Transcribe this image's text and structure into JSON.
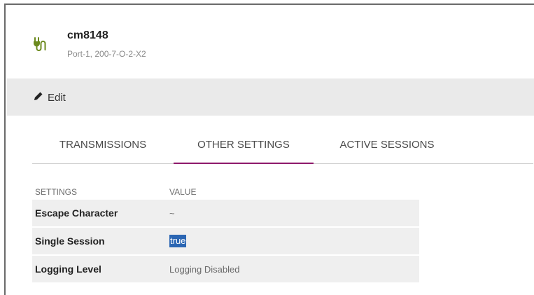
{
  "header": {
    "title": "cm8148",
    "subtitle": "Port-1, 200-7-O-2-X2",
    "icon": "plug-icon",
    "icon_color": "#6c8a1e"
  },
  "toolbar": {
    "edit_label": "Edit"
  },
  "tabs": [
    {
      "label": "TRANSMISSIONS",
      "active": false
    },
    {
      "label": "OTHER SETTINGS",
      "active": true
    },
    {
      "label": "ACTIVE SESSIONS",
      "active": false
    }
  ],
  "accent_color": "#8e1a6b",
  "table": {
    "headers": [
      "SETTINGS",
      "VALUE"
    ],
    "rows": [
      {
        "setting": "Escape Character",
        "value": "~"
      },
      {
        "setting": "Single Session",
        "value": "true",
        "selected": true
      },
      {
        "setting": "Logging Level",
        "value": "Logging Disabled"
      }
    ]
  }
}
